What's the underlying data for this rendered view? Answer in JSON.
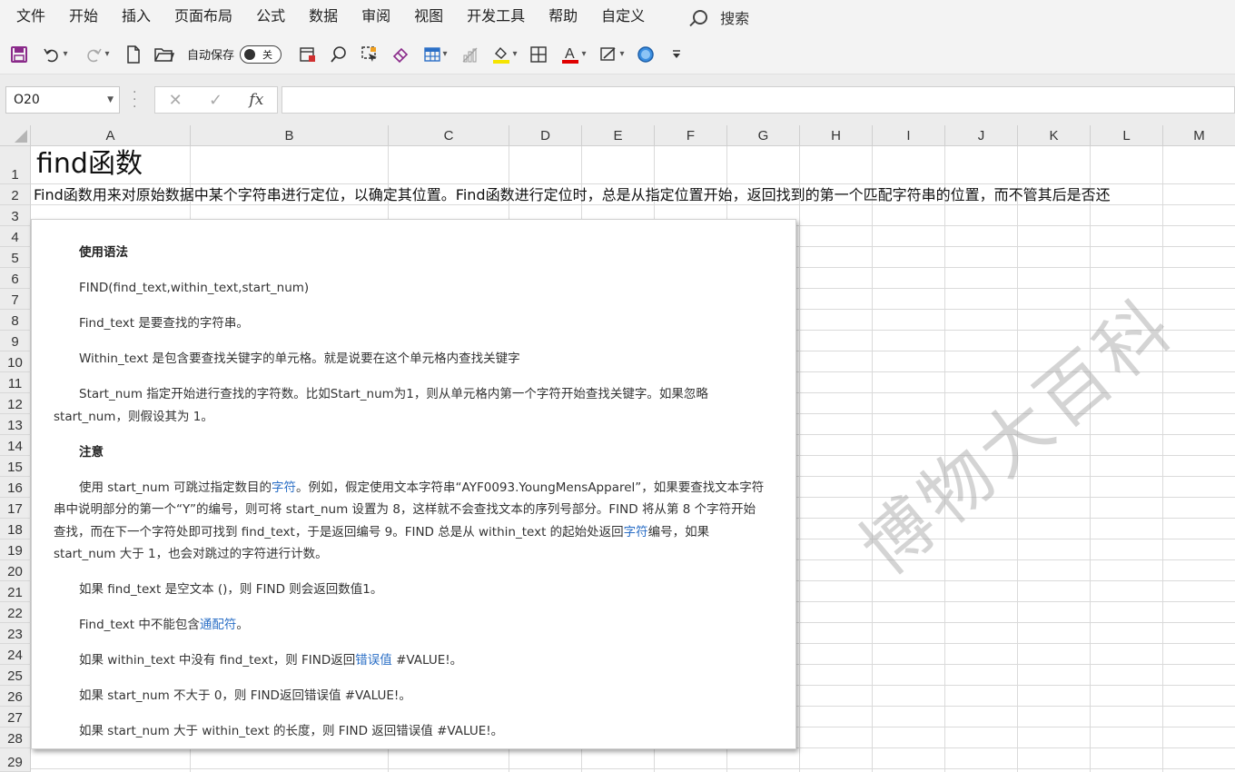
{
  "menu": {
    "items": [
      "文件",
      "开始",
      "插入",
      "页面布局",
      "公式",
      "数据",
      "审阅",
      "视图",
      "开发工具",
      "帮助",
      "自定义"
    ],
    "search_label": "搜索"
  },
  "toolbar": {
    "autosave_label": "自动保存",
    "autosave_state": "关",
    "icons": [
      "save-icon",
      "undo-icon",
      "redo-icon",
      "new-file-icon",
      "open-folder-icon",
      "print-preview-icon",
      "find-icon",
      "select-object-icon",
      "eraser-icon",
      "table-style-icon",
      "chart-icon",
      "fill-color-icon",
      "borders-icon",
      "font-color-icon",
      "format-painter-icon",
      "circle-shape-icon",
      "more-icon"
    ],
    "fill_color": "#f5e400",
    "font_color": "#e00000"
  },
  "formula_bar": {
    "name_box": "O20",
    "cancel_glyph": "✕",
    "enter_glyph": "✓",
    "fx_label": "fx",
    "formula_value": ""
  },
  "sheet": {
    "columns": [
      "A",
      "B",
      "C",
      "D",
      "E",
      "F",
      "G",
      "H",
      "I",
      "J",
      "K",
      "L",
      "M"
    ],
    "rows": [
      "1",
      "2",
      "3",
      "4",
      "5",
      "6",
      "7",
      "8",
      "9",
      "10",
      "11",
      "12",
      "13",
      "14",
      "15",
      "16",
      "17",
      "18",
      "19",
      "20",
      "21",
      "22",
      "23",
      "24",
      "25",
      "26",
      "27",
      "28",
      "29"
    ],
    "cells": {
      "A1": "find函数",
      "A2": "Find函数用来对原始数据中某个字符串进行定位，以确定其位置。Find函数进行定位时，总是从指定位置开始，返回找到的第一个匹配字符串的位置，而不管其后是否还"
    }
  },
  "picture": {
    "usage_heading": "使用语法",
    "syntax": "FIND(find_text,within_text,start_num)",
    "find_text_desc": "Find_text 是要查找的字符串。",
    "within_text_desc": "Within_text 是包含要查找关键字的单元格。就是说要在这个单元格内查找关键字",
    "start_num_desc_1": "Start_num 指定开始进行查找的字符数。比如Start_num为1，则从单元格内第一个字符开始查找关键字。如果忽略",
    "start_num_desc_2": "start_num，则假设其为 1。",
    "notes_heading": "注意",
    "note1_a": "使用 start_num 可跳过指定数目的",
    "note1_link": "字符",
    "note1_b": "。例如，假定使用文本字符串“AYF0093.YoungMensApparel”，如果要查找文本字符",
    "note1_line2": "串中说明部分的第一个“Y”的编号，则可将 start_num 设置为 8，这样就不会查找文本的序列号部分。FIND 将从第 8 个字符开始",
    "note1_line3_a": "查找，而在下一个字符处即可找到 find_text，于是返回编号 9。FIND 总是从 within_text 的起始处返回",
    "note1_line3_link": "字符",
    "note1_line3_b": "编号，如果",
    "note1_line4": "start_num 大于 1，也会对跳过的字符进行计数。",
    "note2": "如果 find_text 是空文本 ()，则 FIND 则会返回数值1。",
    "note3_a": "Find_text 中不能包含",
    "note3_link": "通配符",
    "note3_b": "。",
    "note4_a": "如果 within_text 中没有 find_text，则 FIND返回",
    "note4_link": "错误值",
    "note4_b": " #VALUE!。",
    "note5": "如果 start_num 不大于 0，则 FIND返回错误值 #VALUE!。",
    "note6": "如果 start_num 大于 within_text 的长度，则 FIND 返回错误值 #VALUE!。"
  },
  "watermark": "博物大百科"
}
